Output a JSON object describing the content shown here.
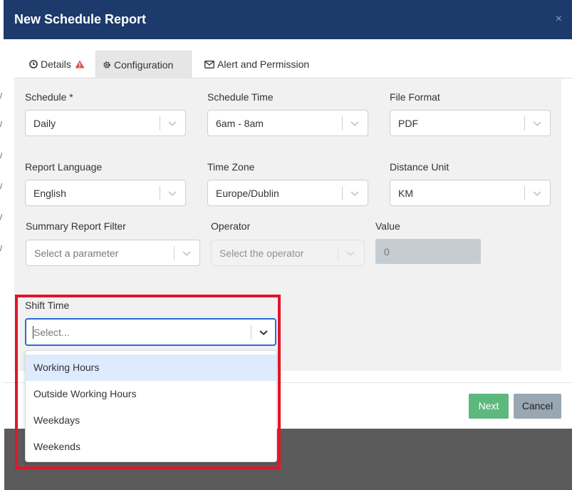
{
  "modal": {
    "title": "New Schedule Report",
    "close_label": "×"
  },
  "tabs": [
    {
      "label": "Details",
      "icon": "clock-icon",
      "has_warning": true
    },
    {
      "label": "Configuration",
      "icon": "gear-icon",
      "active": true
    },
    {
      "label": "Alert and Permission",
      "icon": "envelope-icon"
    }
  ],
  "form": {
    "schedule": {
      "label": "Schedule *",
      "value": "Daily"
    },
    "schedule_time": {
      "label": "Schedule Time",
      "value": "6am - 8am"
    },
    "file_format": {
      "label": "File Format",
      "value": "PDF"
    },
    "report_language": {
      "label": "Report Language",
      "value": "English"
    },
    "time_zone": {
      "label": "Time Zone",
      "value": "Europe/Dublin"
    },
    "distance_unit": {
      "label": "Distance Unit",
      "value": "KM"
    },
    "summary_filter": {
      "label": "Summary Report Filter",
      "placeholder": "Select a parameter"
    },
    "operator": {
      "label": "Operator",
      "placeholder": "Select the operator"
    },
    "value": {
      "label": "Value",
      "value": "0"
    },
    "shift_time": {
      "label": "Shift Time",
      "placeholder": "Select...",
      "options": [
        "Working Hours",
        "Outside Working Hours",
        "Weekdays",
        "Weekends"
      ]
    }
  },
  "buttons": {
    "next": "Next",
    "cancel": "Cancel"
  },
  "colors": {
    "header": "#1c3a6b",
    "next": "#5cb87d",
    "cancel": "#98a7b2",
    "highlight": "#e0162a",
    "option_hover": "#deebff"
  }
}
